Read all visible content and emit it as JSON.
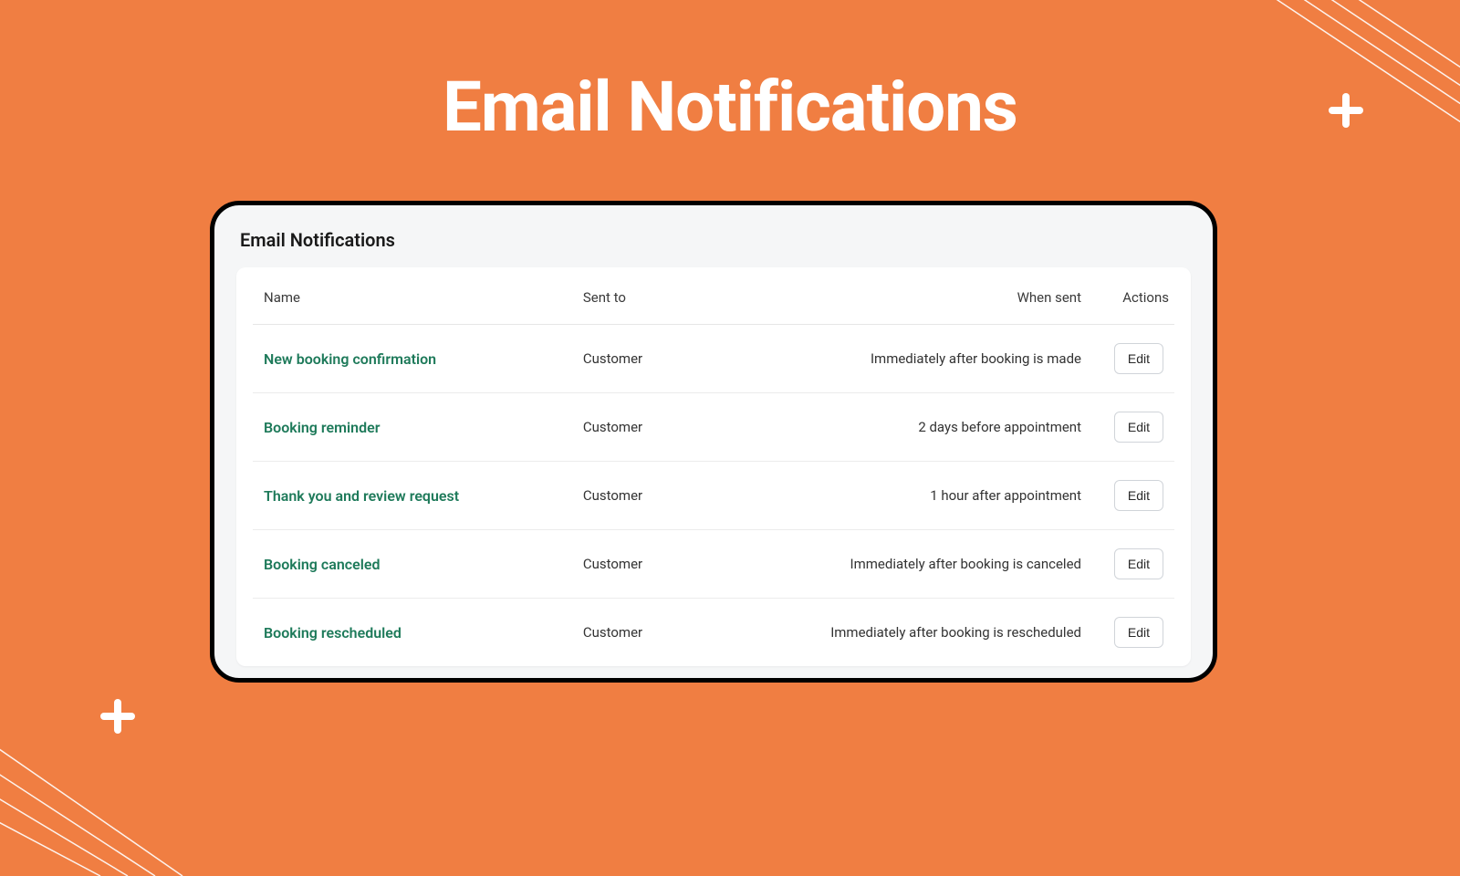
{
  "hero": {
    "title": "Email Notifications"
  },
  "panel": {
    "title": "Email Notifications"
  },
  "table": {
    "columns": {
      "name": "Name",
      "sent_to": "Sent to",
      "when_sent": "When sent",
      "actions": "Actions"
    },
    "rows": [
      {
        "name": "New booking confirmation",
        "sent_to": "Customer",
        "when_sent": "Immediately after booking is made",
        "action_label": "Edit"
      },
      {
        "name": "Booking reminder",
        "sent_to": "Customer",
        "when_sent": "2 days before appointment",
        "action_label": "Edit"
      },
      {
        "name": "Thank you and review request",
        "sent_to": "Customer",
        "when_sent": "1 hour after appointment",
        "action_label": "Edit"
      },
      {
        "name": "Booking canceled",
        "sent_to": "Customer",
        "when_sent": "Immediately after booking is canceled",
        "action_label": "Edit"
      },
      {
        "name": "Booking rescheduled",
        "sent_to": "Customer",
        "when_sent": "Immediately after booking is rescheduled",
        "action_label": "Edit"
      }
    ]
  }
}
